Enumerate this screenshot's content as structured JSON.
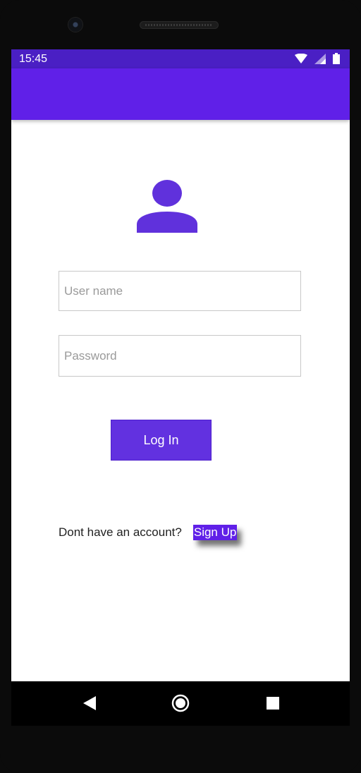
{
  "status_bar": {
    "time": "15:45",
    "icons": [
      "wifi-icon",
      "cellular-signal-icon",
      "battery-icon"
    ]
  },
  "app_bar": {
    "title": ""
  },
  "login_form": {
    "avatar_icon": "user-avatar-icon",
    "username": {
      "value": "",
      "placeholder": "User name"
    },
    "password": {
      "value": "",
      "placeholder": "Password"
    },
    "login_label": "Log In"
  },
  "signup": {
    "prompt": "Dont have an account?",
    "link_label": "Sign Up"
  },
  "nav_bar": {
    "icons": [
      "back-triangle-icon",
      "home-circle-icon",
      "recents-square-icon"
    ]
  },
  "colors": {
    "status_bar": "#4a1fc4",
    "app_bar": "#6020e8",
    "accent": "#6231e0",
    "avatar": "#6031dc"
  }
}
